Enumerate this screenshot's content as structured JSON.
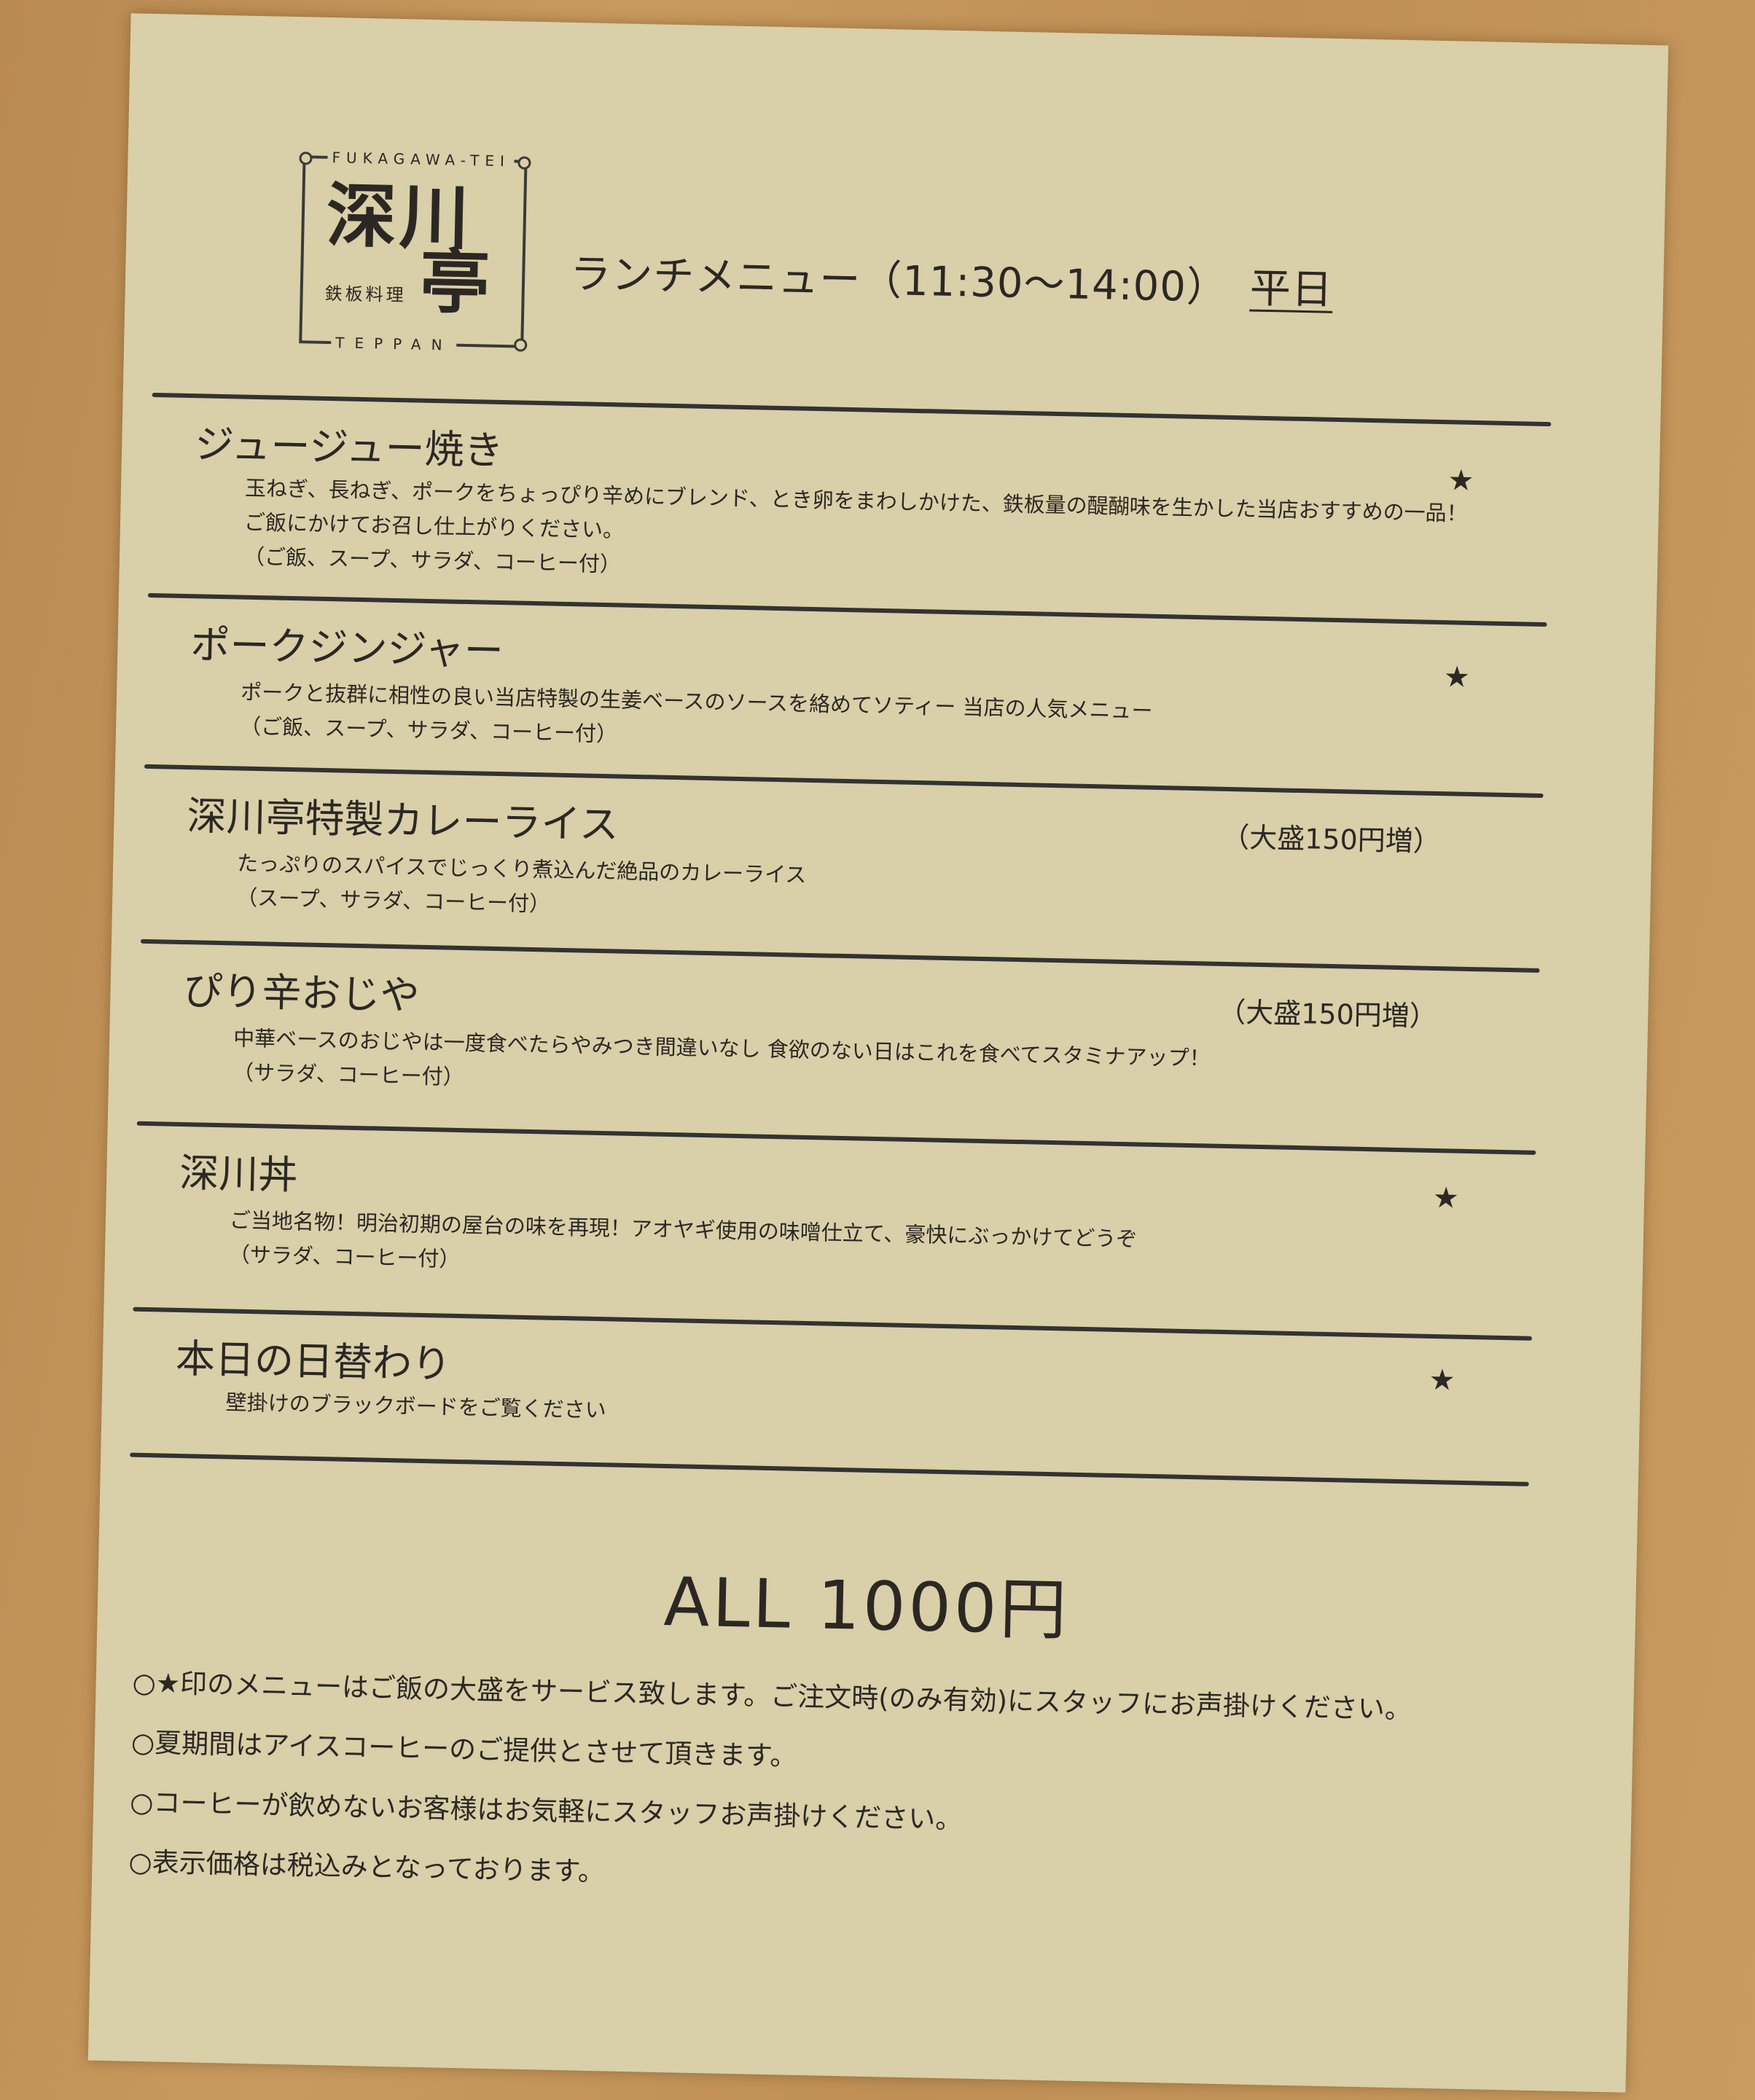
{
  "logo": {
    "name_line1": "深川",
    "name_line2": "亭",
    "romaji": "FUKAGAWA-TEI",
    "subtitle": "鉄板料理",
    "english": "TEPPAN"
  },
  "header": {
    "title": "ランチメニュー（11:30〜14:00）",
    "day": "平日"
  },
  "items": [
    {
      "name": "ジュージュー焼き",
      "desc1": "玉ねぎ、長ねぎ、ポークをちょっぴり辛めにブレンド、とき卵をまわしかけた、鉄板量の醍醐味を生かした当店おすすめの一品！",
      "desc2": "ご飯にかけてお召し仕上がりください。",
      "desc3": "（ご飯、スープ、サラダ、コーヒー付）",
      "mark": "★"
    },
    {
      "name": "ポークジンジャー",
      "desc1": "ポークと抜群に相性の良い当店特製の生姜ベースのソースを絡めてソティー 当店の人気メニュー",
      "desc2": "（ご飯、スープ、サラダ、コーヒー付）",
      "mark": "★"
    },
    {
      "name": "深川亭特製カレーライス",
      "desc1": "たっぷりのスパイスでじっくり煮込んだ絶品のカレーライス",
      "desc2": "（スープ、サラダ、コーヒー付）",
      "extra": "（大盛150円増）"
    },
    {
      "name": "ぴり辛おじや",
      "desc1": "中華ベースのおじやは一度食べたらやみつき間違いなし 食欲のない日はこれを食べてスタミナアップ！",
      "desc2": "（サラダ、コーヒー付）",
      "extra": "（大盛150円増）"
    },
    {
      "name": "深川丼",
      "desc1": "ご当地名物！明治初期の屋台の味を再現！アオヤギ使用の味噌仕立て、豪快にぶっかけてどうぞ",
      "desc2": "（サラダ、コーヒー付）",
      "mark": "★"
    },
    {
      "name": "本日の日替わり",
      "desc1": "壁掛けのブラックボードをご覧ください",
      "mark": "★"
    }
  ],
  "price": "ALL 1000円",
  "notes": [
    "○★印のメニューはご飯の大盛をサービス致します。ご注文時(のみ有効)にスタッフにお声掛けください。",
    "○夏期間はアイスコーヒーのご提供とさせて頂きます。",
    "○コーヒーが飲めないお客様はお気軽にスタッフお声掛けください。",
    "○表示価格は税込みとなっております。"
  ]
}
